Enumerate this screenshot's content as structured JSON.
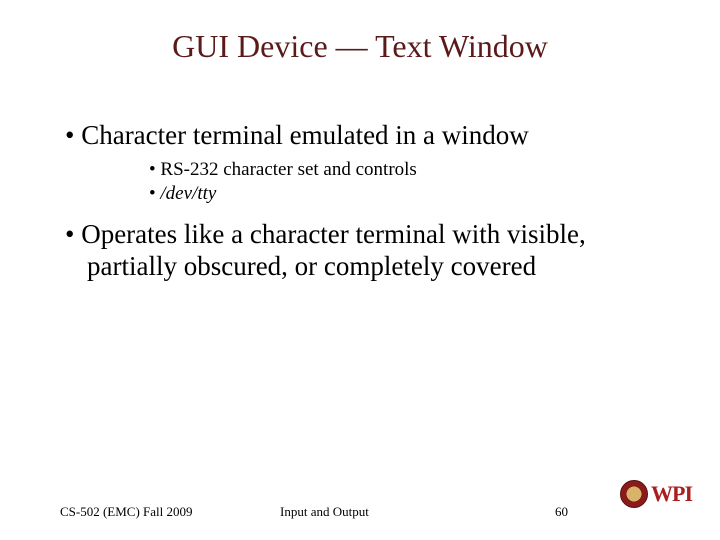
{
  "title": "GUI Device — Text Window",
  "bullets": {
    "b1": "Character terminal emulated in a window",
    "b1_sub1": "RS-232 character set and controls",
    "b1_sub2": "/dev/tty",
    "b2": "Operates like a character terminal with visible, partially obscured, or completely covered"
  },
  "footer": {
    "left": "CS-502 (EMC) Fall 2009",
    "center": "Input and Output",
    "pageno": "60",
    "logo_text": "WPI"
  }
}
